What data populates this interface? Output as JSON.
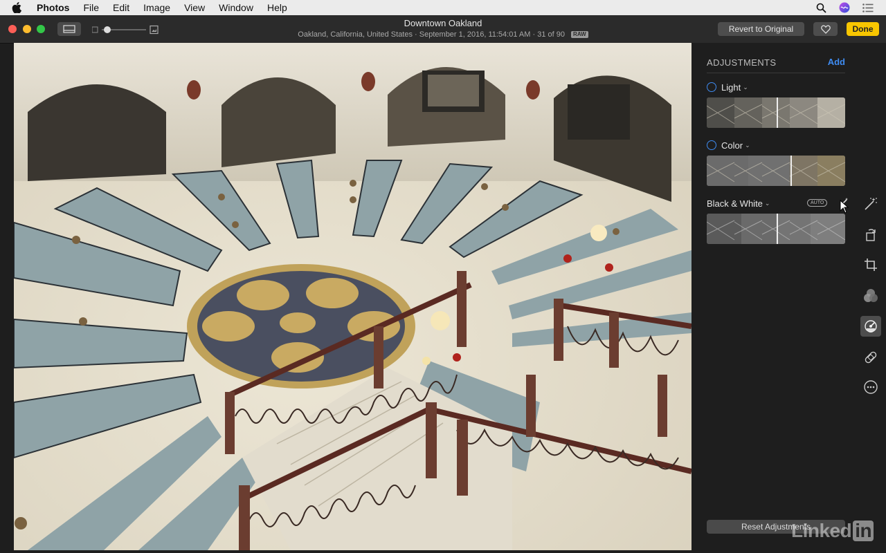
{
  "menubar": {
    "app_name": "Photos",
    "items": [
      "File",
      "Edit",
      "Image",
      "View",
      "Window",
      "Help"
    ]
  },
  "toolbar": {
    "photo_title": "Downtown Oakland",
    "location": "Oakland, California, United States",
    "datetime": "September 1, 2016, 11:54:01 AM",
    "position": "31 of 90",
    "format_badge": "RAW",
    "revert_label": "Revert to Original",
    "done_label": "Done"
  },
  "adjustments": {
    "header": "ADJUSTMENTS",
    "add_label": "Add",
    "sections": [
      {
        "label": "Light"
      },
      {
        "label": "Color"
      },
      {
        "label": "Black & White",
        "badge": "AUTO"
      }
    ],
    "reset_label": "Reset Adjustments"
  },
  "tools": [
    "magic-wand-icon",
    "rotate-icon",
    "crop-icon",
    "filters-icon",
    "adjust-icon",
    "retouch-icon",
    "more-icon"
  ],
  "colors": {
    "accent": "#3f8cf2",
    "done": "#f8c600"
  },
  "watermark": {
    "text": "Linked",
    "box": "in"
  }
}
